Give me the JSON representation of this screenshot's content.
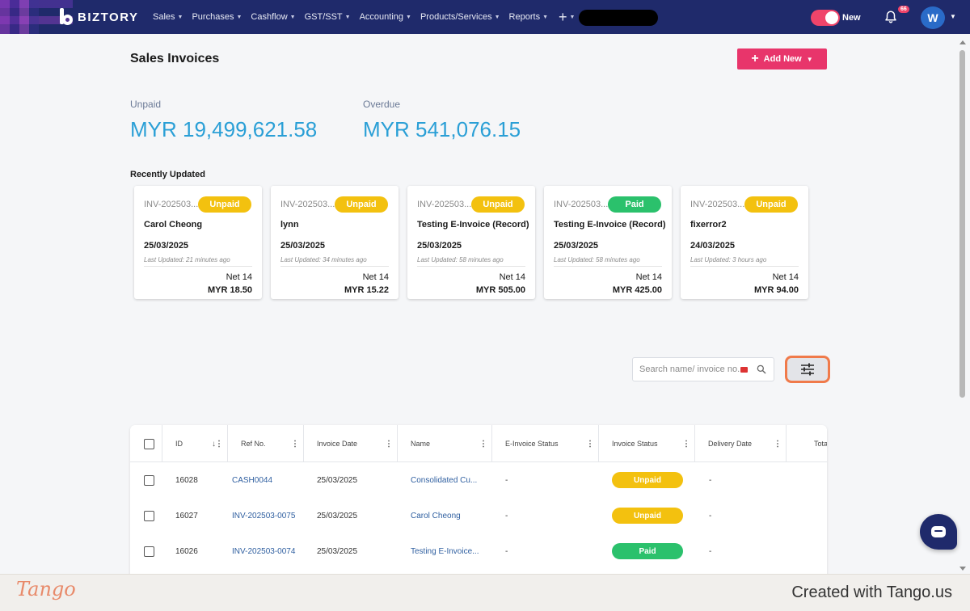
{
  "nav": {
    "brand": "BIZTORY",
    "items": [
      "Sales",
      "Purchases",
      "Cashflow",
      "GST/SST",
      "Accounting",
      "Products/Services",
      "Reports"
    ],
    "plus": "+",
    "toggle_label": "New",
    "notification_count": "66",
    "avatar_initial": "W"
  },
  "page": {
    "title": "Sales Invoices",
    "add_new_label": "Add New"
  },
  "stats": {
    "unpaid_label": "Unpaid",
    "unpaid_value": "MYR 19,499,621.58",
    "overdue_label": "Overdue",
    "overdue_value": "MYR 541,076.15"
  },
  "recent": {
    "title": "Recently Updated",
    "cards": [
      {
        "inv": "INV-202503...",
        "status": "Unpaid",
        "name": "Carol Cheong",
        "date": "25/03/2025",
        "updated": "Last Updated: 21 minutes ago",
        "term": "Net 14",
        "amount": "MYR 18.50"
      },
      {
        "inv": "INV-202503...",
        "status": "Unpaid",
        "name": "lynn",
        "date": "25/03/2025",
        "updated": "Last Updated: 34 minutes ago",
        "term": "Net 14",
        "amount": "MYR 15.22"
      },
      {
        "inv": "INV-202503...",
        "status": "Unpaid",
        "name": "Testing E-Invoice (Record)",
        "date": "25/03/2025",
        "updated": "Last Updated: 58 minutes ago",
        "term": "Net 14",
        "amount": "MYR 505.00"
      },
      {
        "inv": "INV-202503...",
        "status": "Paid",
        "name": "Testing E-Invoice (Record)",
        "date": "25/03/2025",
        "updated": "Last Updated: 58 minutes ago",
        "term": "Net 14",
        "amount": "MYR 425.00"
      },
      {
        "inv": "INV-202503...",
        "status": "Unpaid",
        "name": "fixerror2",
        "date": "24/03/2025",
        "updated": "Last Updated: 3 hours ago",
        "term": "Net 14",
        "amount": "MYR 94.00"
      }
    ]
  },
  "search": {
    "placeholder": "Search name/ invoice no."
  },
  "table": {
    "headers": [
      "ID",
      "Ref No.",
      "Invoice Date",
      "Name",
      "E-Invoice Status",
      "Invoice Status",
      "Delivery Date",
      "Tota"
    ],
    "rows": [
      {
        "id": "16028",
        "ref": "CASH0044",
        "date": "25/03/2025",
        "name": "Consolidated Cu...",
        "einv": "-",
        "status": "Unpaid",
        "delivery": "-"
      },
      {
        "id": "16027",
        "ref": "INV-202503-0075",
        "date": "25/03/2025",
        "name": "Carol Cheong",
        "einv": "-",
        "status": "Unpaid",
        "delivery": "-"
      },
      {
        "id": "16026",
        "ref": "INV-202503-0074",
        "date": "25/03/2025",
        "name": "Testing E-Invoice...",
        "einv": "-",
        "status": "Paid",
        "delivery": "-"
      }
    ]
  },
  "footer": {
    "brand": "Tango",
    "created": "Created with Tango.us"
  },
  "colors": {
    "nav_bg": "#1f2a6b",
    "accent": "#e8356b",
    "stat_blue": "#2a9fd6",
    "unpaid": "#f3c10f",
    "paid": "#2bc16c"
  }
}
